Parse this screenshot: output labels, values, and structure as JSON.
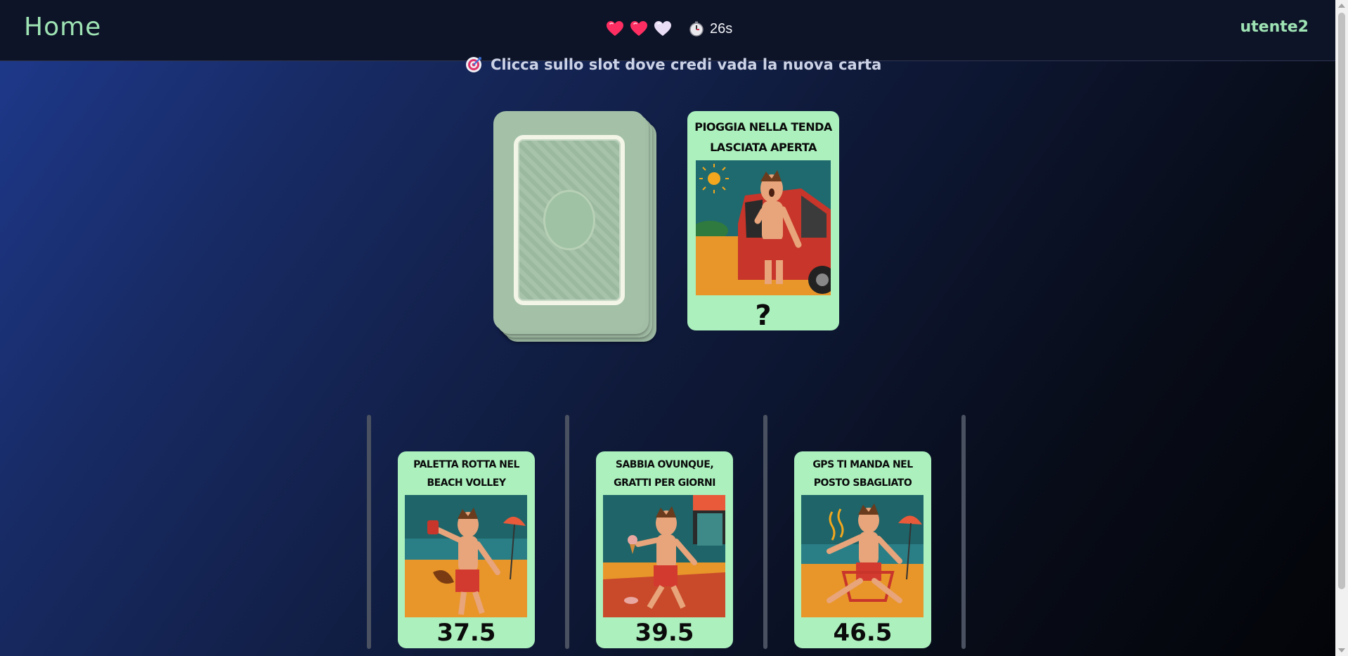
{
  "header": {
    "home_label": "Home",
    "timer_value": "26s",
    "username": "utente2",
    "lives": [
      {
        "state": "full",
        "color": "#ff2e62"
      },
      {
        "state": "full",
        "color": "#ff2e62"
      },
      {
        "state": "empty",
        "color": "#e9dcf5"
      }
    ]
  },
  "instruction": {
    "text": "Clicca sullo slot dove credi vada la nuova carta",
    "icon": "target-icon"
  },
  "new_card": {
    "title": "PIOGGIA NELLA TENDA LASCIATA APERTA",
    "value": "?"
  },
  "timeline": [
    {
      "title": "PALETTA ROTTA NEL BEACH VOLLEY",
      "value": "37.5"
    },
    {
      "title": "SABBIA OVUNQUE, GRATTI PER GIORNI",
      "value": "39.5"
    },
    {
      "title": "GPS TI MANDA NEL POSTO SBAGLIATO",
      "value": "46.5"
    }
  ],
  "colors": {
    "accent_green": "#9ee3b4",
    "card_bg": "#abf0bd",
    "heart_full": "#ff2e62"
  }
}
